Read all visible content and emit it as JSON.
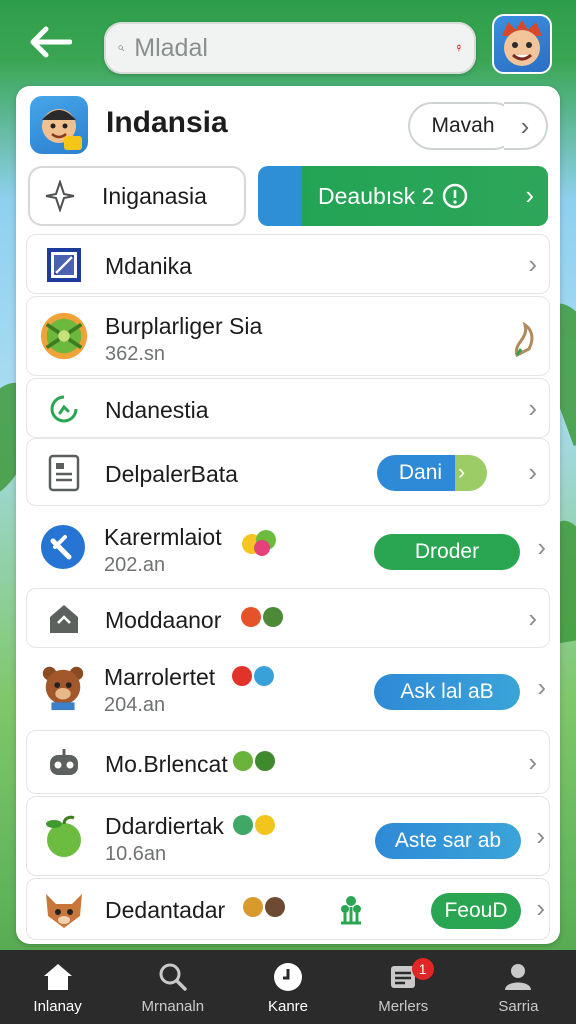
{
  "header": {
    "search_value": "Mladal"
  },
  "app": {
    "title": "Indansia",
    "head_button": "Mavah",
    "chip_label": "Iniganasia",
    "cta_label": "Deaubısk 2"
  },
  "rows": [
    {
      "title": "Mdanika"
    },
    {
      "title": "Burplarliger Sia",
      "sub": "362.sn"
    },
    {
      "title": "Ndanestia"
    },
    {
      "title": "DelpalerBata",
      "pill": "Dani"
    },
    {
      "title": "Karermlaiot",
      "sub": "202.an",
      "pill": "Droder"
    },
    {
      "title": "Moddaanor"
    },
    {
      "title": "Marrolertet",
      "sub": "204.an",
      "pill": "Ask lal aB"
    },
    {
      "title": "Mo.Brlencat"
    },
    {
      "title": "Ddardiertak",
      "sub": "10.6an",
      "pill": "Aste sar ab"
    },
    {
      "title": "Dedantadar",
      "pill": "FeouD"
    }
  ],
  "nav": [
    {
      "label": "Inlanay",
      "icon": "home-icon"
    },
    {
      "label": "Mrnanaln",
      "icon": "search-icon"
    },
    {
      "label": "Kanre",
      "icon": "clock-icon"
    },
    {
      "label": "Merlers",
      "icon": "inbox-icon",
      "badge": "1"
    },
    {
      "label": "Sarria",
      "icon": "profile-icon"
    }
  ],
  "colors": {
    "brand_green": "#2aa653",
    "accent_blue": "#2e8ad6",
    "nav_bg": "#2b2b2b",
    "badge_red": "#e02626"
  }
}
